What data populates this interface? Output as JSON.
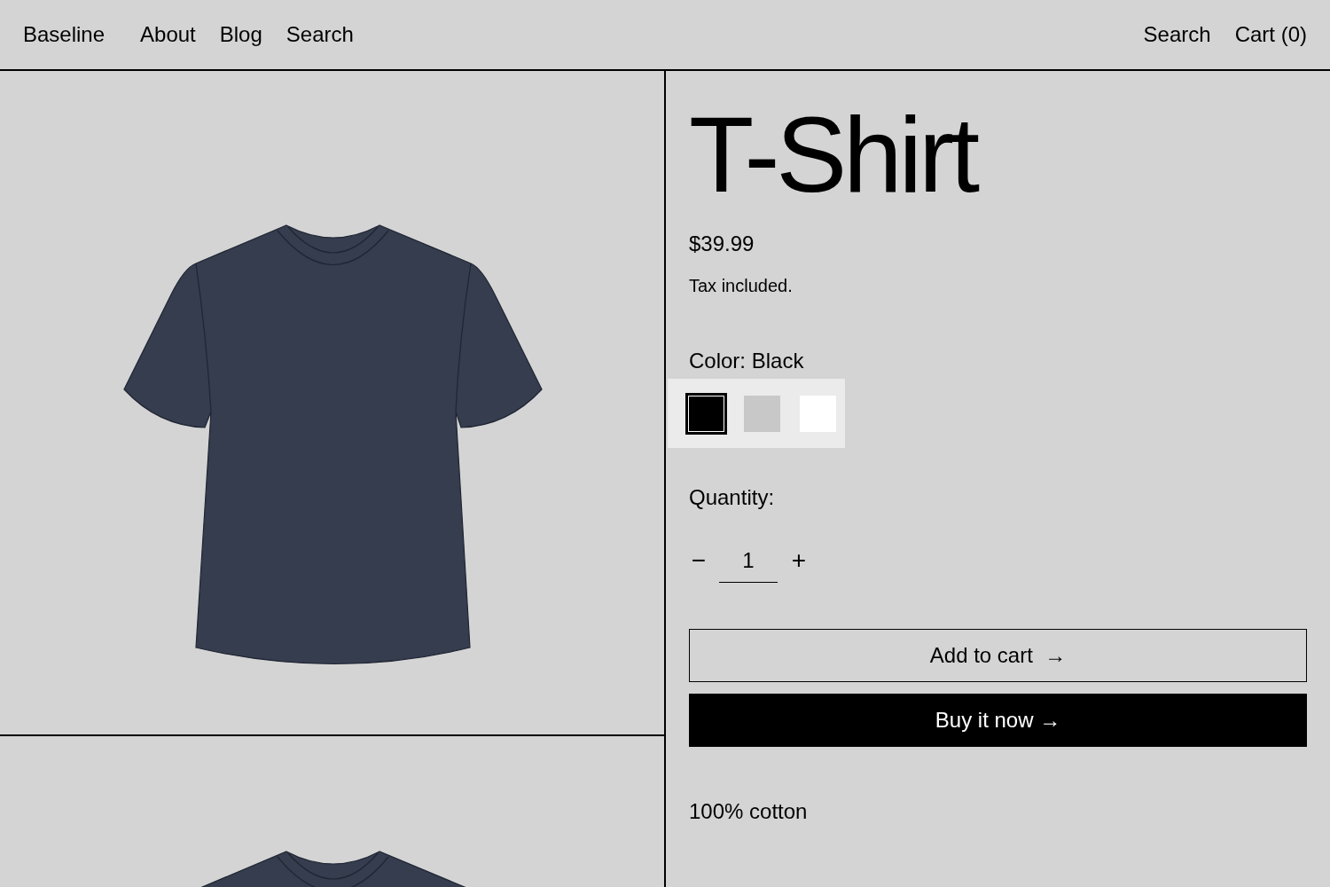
{
  "nav": {
    "brand": "Baseline",
    "links": [
      "About",
      "Blog",
      "Search"
    ],
    "right": [
      "Search",
      "Cart (0)"
    ]
  },
  "product": {
    "title": "T-Shirt",
    "price": "$39.99",
    "tax_note": "Tax included.",
    "color_label": "Color: Black",
    "swatches": [
      {
        "color": "#000000",
        "selected": true
      },
      {
        "color": "#c8c8c8",
        "selected": false
      },
      {
        "color": "#ffffff",
        "selected": false
      }
    ],
    "quantity_label": "Quantity:",
    "quantity": {
      "decrement": "−",
      "value": "1",
      "increment": "+"
    },
    "add_to_cart": "Add to cart  →",
    "buy_now": "Buy it now →",
    "description": "100% cotton"
  }
}
